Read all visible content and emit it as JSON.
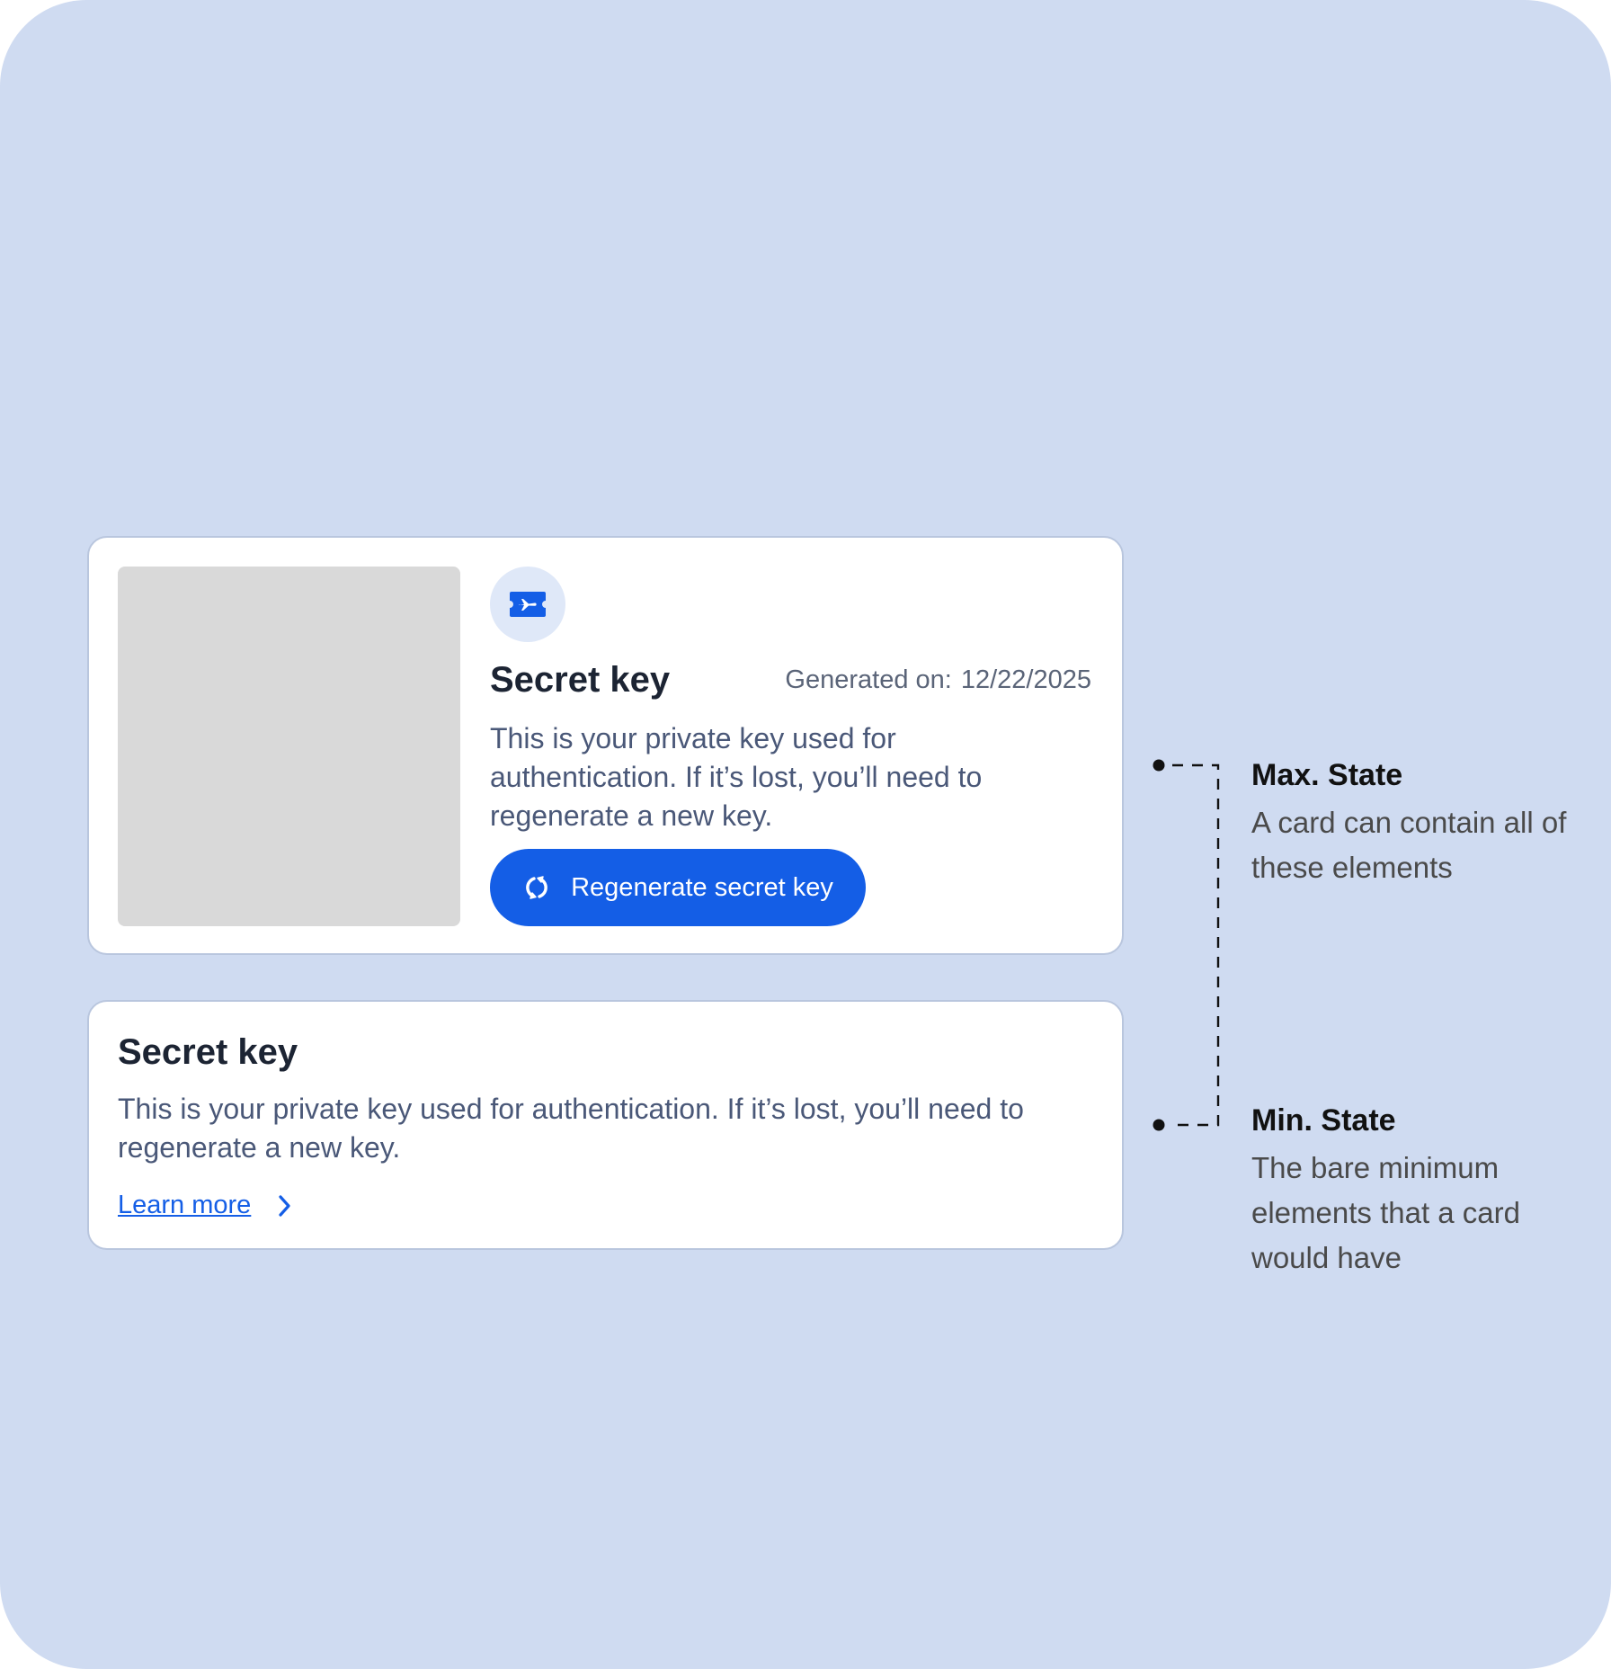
{
  "max_card": {
    "title": "Secret key",
    "generated_label": "Generated on:",
    "generated_date": "12/22/2025",
    "description": "This is your private key used for authentication. If it’s lost, you’ll need to regenerate a new key.",
    "button_label": "Regenerate secret key",
    "icon": "ticket-plane-icon",
    "button_icon": "refresh-icon"
  },
  "min_card": {
    "title": "Secret key",
    "description": "This is your private key used for authentication. If it’s lost, you’ll need to regenerate a new key.",
    "link_label": "Learn more",
    "link_icon": "chevron-right-icon"
  },
  "annotations": {
    "max": {
      "title": "Max. State",
      "text": "A card can contain all of these elements"
    },
    "min": {
      "title": "Min. State",
      "text": "The bare minimum elements that a card would have"
    }
  },
  "colors": {
    "background": "#cfdbf1",
    "primary": "#145ee6",
    "card": "#ffffff",
    "media_placeholder": "#d9d9d9",
    "title_text": "#1c2433",
    "body_text": "#4a5878"
  }
}
